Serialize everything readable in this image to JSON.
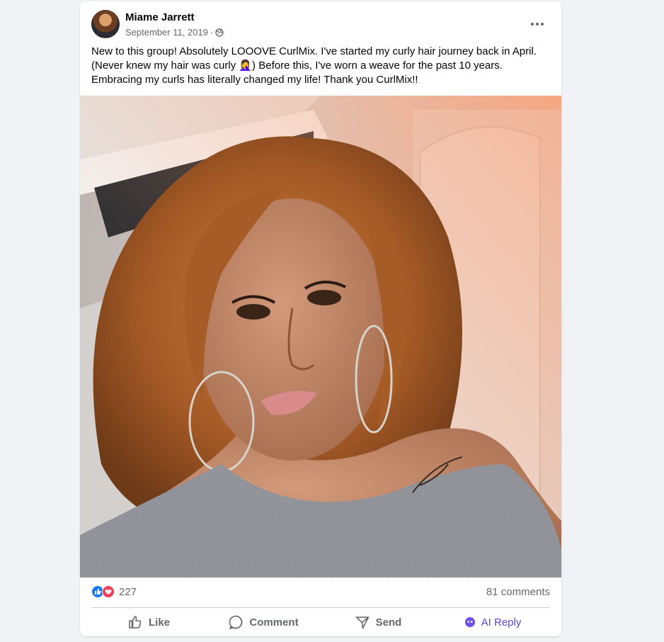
{
  "post": {
    "author": "Miame Jarrett",
    "date": "September 11, 2019",
    "separator": "·",
    "audience_icon": "globe-icon",
    "text_lines": [
      "New to this group! Absolutely LOOOVE CurlMix. I've started my curly hair journey back in April.",
      "(Never knew my hair was curly 🤦‍♀️) Before this, I've worn a weave for the past 10 years.",
      "Embracing my curls has literally changed my life! Thank you CurlMix!!"
    ]
  },
  "reactions": {
    "count": "227",
    "icons": [
      "like-reaction-icon",
      "love-reaction-icon"
    ],
    "comments": "81 comments"
  },
  "actions": {
    "like": "Like",
    "comment": "Comment",
    "send": "Send",
    "ai_reply": "AI Reply"
  },
  "colors": {
    "background": "#f0f2f5",
    "card": "#ffffff",
    "secondary_text": "#65676b",
    "like_blue": "#1877f2",
    "love_red": "#f33e58",
    "ai_purple": "#5b46e0"
  }
}
